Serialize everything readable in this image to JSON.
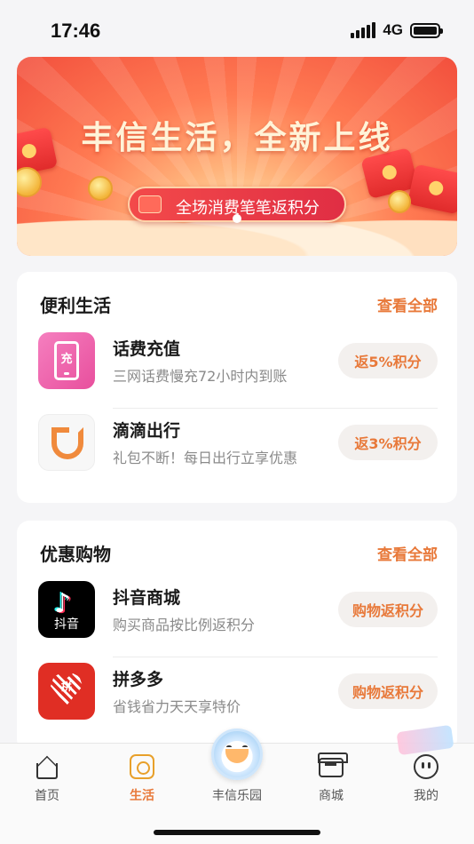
{
  "status_bar": {
    "time": "17:46",
    "network": "4G"
  },
  "banner": {
    "title": "丰信生活，全新上线",
    "subtitle": "全场消费笔笔返积分"
  },
  "convenience": {
    "title": "便利生活",
    "more": "查看全部",
    "items": [
      {
        "title": "话费充值",
        "subtitle": "三网话费慢充72小时内到账",
        "badge": "返5%积分",
        "icon": "phone-recharge-icon",
        "icon_char": "充"
      },
      {
        "title": "滴滴出行",
        "subtitle": "礼包不断！每日出行立享优惠",
        "badge": "返3%积分",
        "icon": "didi-icon"
      }
    ]
  },
  "shopping": {
    "title": "优惠购物",
    "more": "查看全部",
    "items": [
      {
        "title": "抖音商城",
        "subtitle": "购买商品按比例返积分",
        "badge": "购物返积分",
        "icon": "douyin-icon",
        "icon_text": "抖音"
      },
      {
        "title": "拼多多",
        "subtitle": "省钱省力天天享特价",
        "badge": "购物返积分",
        "icon": "pinduoduo-icon",
        "icon_char": "拼"
      }
    ]
  },
  "tab_bar": {
    "active": "生活",
    "tabs": [
      {
        "label": "首页",
        "icon": "home-icon"
      },
      {
        "label": "生活",
        "icon": "life-icon"
      },
      {
        "label": "丰信乐园",
        "icon": "mascot-icon"
      },
      {
        "label": "商城",
        "icon": "store-icon"
      },
      {
        "label": "我的",
        "icon": "profile-icon"
      }
    ]
  },
  "colors": {
    "accent": "#e8793a",
    "active_tab_icon": "#e8a02a",
    "banner_red": "#f24f3d"
  }
}
